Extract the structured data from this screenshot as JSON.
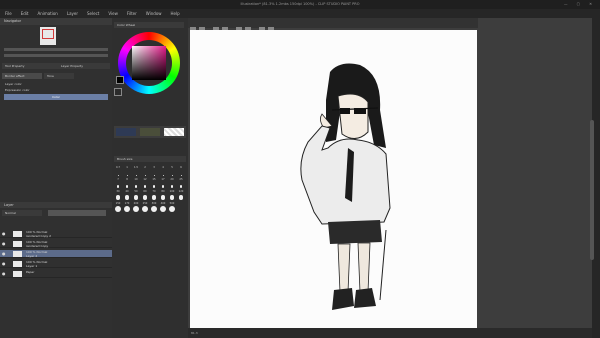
{
  "window": {
    "title": "Illustration* (81.3% 1.2mbs 150dpi 100%) - CLIP STUDIO PAINT PRO"
  },
  "menu": [
    "File",
    "Edit",
    "Animation",
    "Layer",
    "Select",
    "View",
    "Filter",
    "Window",
    "Help"
  ],
  "panels": {
    "navigator": "Navigator",
    "tool_property": "Tool Property",
    "layer_property": "Layer Property",
    "border_effect": "Border effect",
    "tone": "Tone",
    "layer_color": "Layer color",
    "expression_color": "Expression color",
    "color_mode": "Color",
    "color_wheel": "Color Wheel",
    "color_set": "Color Set",
    "brush_size": "Brush size",
    "layer": "Layer"
  },
  "layers": {
    "blend": "Normal",
    "opacity": "100",
    "items": [
      {
        "opacity": "100 % Normal",
        "name": "rendered Copy 2",
        "selected": false
      },
      {
        "opacity": "100 % Normal",
        "name": "rendered Copy",
        "selected": false
      },
      {
        "opacity": "100 % Normal",
        "name": "Layer 2",
        "selected": true
      },
      {
        "opacity": "100 % Normal",
        "name": "Layer 1",
        "selected": false
      },
      {
        "opacity": "",
        "name": "Paper",
        "selected": false
      }
    ]
  },
  "brush_sizes": [
    "0.7",
    "1",
    "1.5",
    "2",
    "3",
    "4",
    "5",
    "6",
    "7",
    "8",
    "10",
    "12",
    "15",
    "17",
    "20",
    "25",
    "30",
    "40",
    "50",
    "60",
    "70",
    "80",
    "100",
    "120",
    "150",
    "170",
    "200",
    "250",
    "300",
    "400",
    "500"
  ],
  "status": {
    "zoom": "81.3"
  },
  "colors": {
    "accent": "#5c6b8a",
    "canvas_bg": "#3d3d3d",
    "paper": "#fcfcfc"
  }
}
